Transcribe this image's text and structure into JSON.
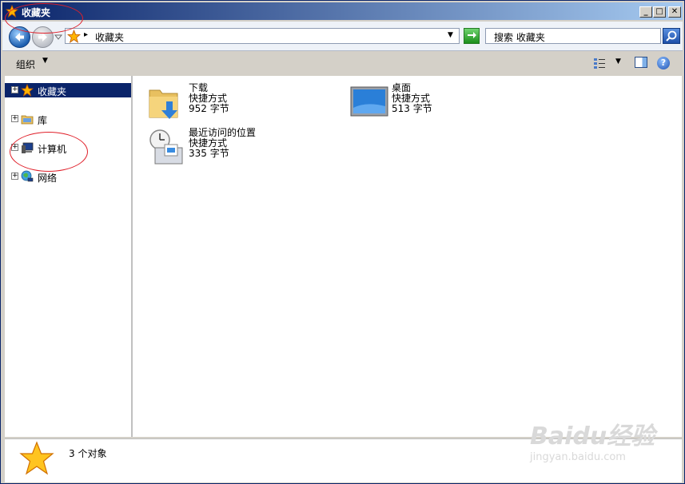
{
  "window": {
    "title": "收藏夹",
    "minimize_glyph": "_",
    "maximize_glyph": "□",
    "close_glyph": "✕"
  },
  "address": {
    "breadcrumb_arrow": "▸",
    "breadcrumb": "收藏夹",
    "dropdown_glyph": "▼",
    "search_placeholder": "搜索 收藏夹"
  },
  "toolbar": {
    "organize_label": "组织",
    "dropdown_glyph": "▼"
  },
  "nav": {
    "items": [
      {
        "label": "收藏夹",
        "icon": "star-icon",
        "selected": true
      },
      {
        "label": "库",
        "icon": "library-icon",
        "selected": false
      },
      {
        "label": "计算机",
        "icon": "computer-icon",
        "selected": false
      },
      {
        "label": "网络",
        "icon": "network-icon",
        "selected": false
      }
    ],
    "expand_glyph": "+"
  },
  "files": [
    {
      "name": "下载",
      "type": "快捷方式",
      "size": "952 字节",
      "icon": "downloads-folder-icon"
    },
    {
      "name": "桌面",
      "type": "快捷方式",
      "size": "513 字节",
      "icon": "desktop-icon"
    },
    {
      "name": "最近访问的位置",
      "type": "快捷方式",
      "size": "335 字节",
      "icon": "recent-places-icon"
    }
  ],
  "status": {
    "count_text": "3 个对象"
  },
  "watermark": {
    "brand": "Baidu经验",
    "url": "jingyan.baidu.com"
  },
  "colors": {
    "accent": "#0a246a",
    "annotation": "#e0202a"
  }
}
